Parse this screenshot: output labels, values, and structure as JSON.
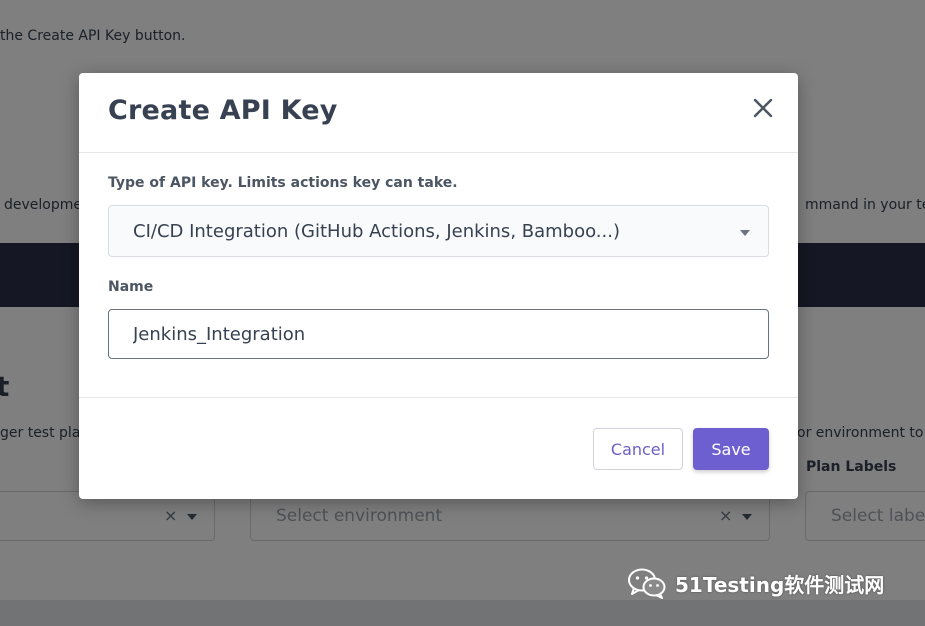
{
  "background": {
    "intro_text": "the Create API Key button.",
    "left_snippet": "developme",
    "right_snippet": "mmand in your ter",
    "heading_fragment": "t",
    "left_snippet_2": "ger test pla",
    "right_snippet_2": "or environment to",
    "plan_labels_label": "Plan Labels",
    "environment_placeholder": "Select environment",
    "labels_placeholder": "Select labe",
    "clear_symbol": "×"
  },
  "modal": {
    "title": "Create API Key",
    "type_label": "Type of API key. Limits actions key can take.",
    "type_value": "CI/CD Integration (GitHub Actions, Jenkins, Bamboo...)",
    "name_label": "Name",
    "name_value": "Jenkins_Integration",
    "cancel_label": "Cancel",
    "save_label": "Save"
  },
  "watermark": {
    "text": "51Testing软件测试网"
  },
  "colors": {
    "accent": "#6d5fd0",
    "banner": "#2b2f48",
    "overlay": "rgba(0,0,0,0.5)"
  },
  "icons": {
    "close": "close-icon",
    "dropdown": "chevron-down-icon",
    "wechat": "wechat-icon"
  }
}
